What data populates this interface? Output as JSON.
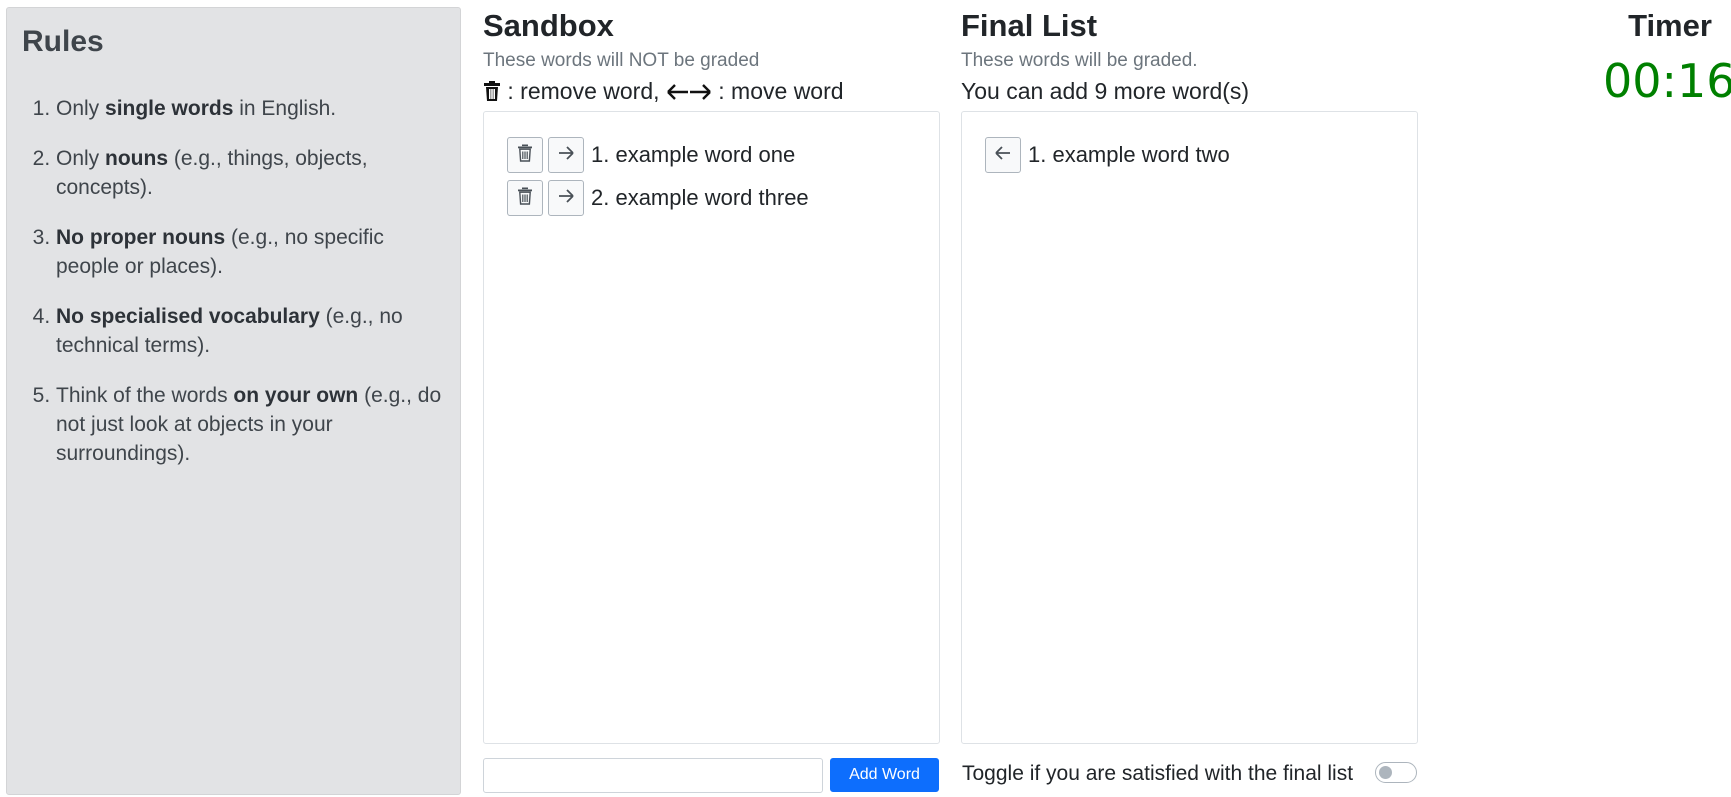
{
  "rules": {
    "title": "Rules",
    "items": [
      {
        "pre": "Only ",
        "bold": "single words",
        "post": " in English."
      },
      {
        "pre": "Only ",
        "bold": "nouns",
        "post": " (e.g., things, objects, concepts)."
      },
      {
        "pre": "",
        "bold": "No proper nouns",
        "post": " (e.g., no specific people or places)."
      },
      {
        "pre": "",
        "bold": "No specialised vocabulary",
        "post": " (e.g., no technical terms)."
      },
      {
        "pre": "Think of the words ",
        "bold": "on your own",
        "post": " (e.g., do not just look at objects in your surroundings)."
      }
    ]
  },
  "sandbox": {
    "title": "Sandbox",
    "subtitle": "These words will NOT be graded",
    "hint_remove": " : remove word, ",
    "hint_move": " : move word",
    "words": [
      "1. example word one",
      "2. example word three"
    ]
  },
  "final_list": {
    "title": "Final List",
    "subtitle": "These words will be graded.",
    "remaining": "You can add 9 more word(s)",
    "words": [
      "1. example word two"
    ]
  },
  "input": {
    "value": "",
    "placeholder": ""
  },
  "add_button_label": "Add Word",
  "toggle": {
    "label": "Toggle if you are satisfied with the final list",
    "checked": false
  },
  "timer": {
    "title": "Timer",
    "value": "00:16",
    "color": "#008000"
  },
  "colors": {
    "accent": "#0d6efd",
    "rules_bg": "#e2e3e5"
  },
  "icons": {
    "remove": "trash-icon",
    "move_right": "arrow-right-icon",
    "move_left": "arrow-left-icon"
  }
}
